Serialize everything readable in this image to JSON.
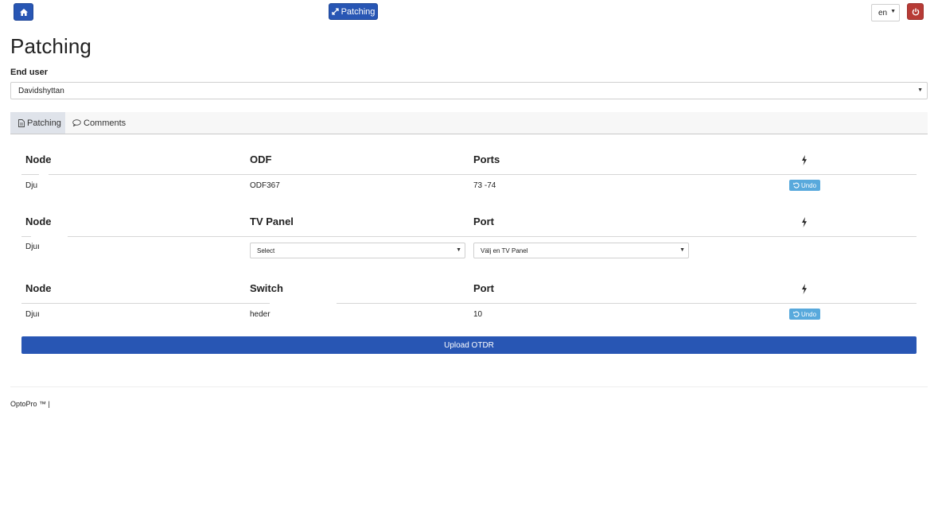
{
  "navbar": {
    "home_icon": "home-icon",
    "patching_button_label": "Patching",
    "patching_icon": "expand-arrows-icon",
    "language_value": "en",
    "power_icon": "power-icon"
  },
  "page": {
    "title": "Patching",
    "end_user_label": "End user",
    "end_user_value": "Davidshyttan"
  },
  "tabs": [
    {
      "label": "Patching",
      "icon": "document-icon",
      "active": true
    },
    {
      "label": "Comments",
      "icon": "comment-icon",
      "active": false
    }
  ],
  "odf_section": {
    "headers": {
      "node": "Node",
      "middle": "ODF",
      "ports": "Ports"
    },
    "row": {
      "node": "Dju",
      "odf": "ODF367",
      "ports": "73 -74",
      "undo_label": "Undo"
    }
  },
  "tv_section": {
    "headers": {
      "node": "Node",
      "middle": "TV Panel",
      "port": "Port"
    },
    "row": {
      "node": "Djuı",
      "tv_panel_select": "Select",
      "port_select": "Välj en TV Panel"
    }
  },
  "switch_section": {
    "headers": {
      "node": "Node",
      "middle": "Switch",
      "port": "Port"
    },
    "row": {
      "node": "Djuı",
      "switch": "heder",
      "port": "10",
      "undo_label": "Undo"
    }
  },
  "upload_button_label": "Upload OTDR",
  "footer": {
    "text": "OptoPro ™ |"
  },
  "colors": {
    "primary": "#2856b4",
    "danger": "#b73b36",
    "info": "#58a9dc",
    "tab_active_bg": "#dfe3ea"
  }
}
